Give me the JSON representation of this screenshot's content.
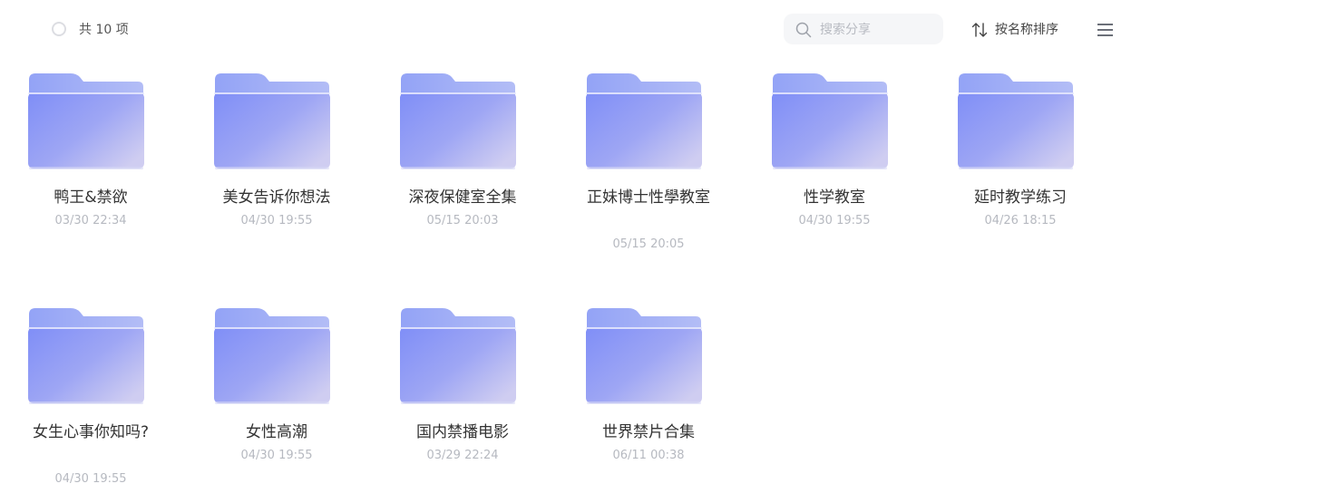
{
  "header": {
    "count_label": "共 10 项",
    "search_placeholder": "搜索分享",
    "sort_label": "按名称排序"
  },
  "icons": {
    "select": "circle-checkbox-icon",
    "search": "search-icon",
    "sort": "sort-arrows-icon",
    "menu": "list-view-icon",
    "folder": "folder-icon"
  },
  "colors": {
    "folder_back": "#9aa8f6",
    "folder_front_start": "#7f8ef7",
    "folder_front_end": "#c9c8f1",
    "date_text": "#b6b9c0"
  },
  "folders": [
    {
      "name": "鸭王&禁欲",
      "date": "03/30 22:34"
    },
    {
      "name": "美女告诉你想法",
      "date": "04/30 19:55"
    },
    {
      "name": "深夜保健室全集",
      "date": "05/15 20:03"
    },
    {
      "name": "正妹博士性學教室",
      "date": "05/15 20:05"
    },
    {
      "name": "性学教室",
      "date": "04/30 19:55"
    },
    {
      "name": "延时教学练习",
      "date": "04/26 18:15"
    },
    {
      "name": "女生心事你知吗?",
      "date": "04/30 19:55"
    },
    {
      "name": "女性高潮",
      "date": "04/30 19:55"
    },
    {
      "name": "国内禁播电影",
      "date": "03/29 22:24"
    },
    {
      "name": "世界禁片合集",
      "date": "06/11 00:38"
    }
  ]
}
